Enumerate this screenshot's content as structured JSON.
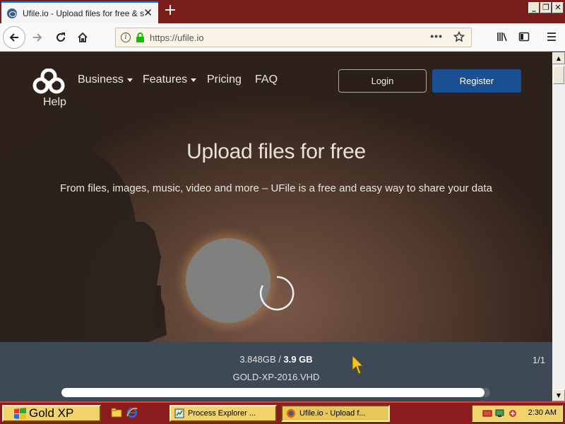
{
  "browser": {
    "tab_title": "Ufile.io - Upload files for free & sh",
    "url": "https://ufile.io",
    "more_icon_text": "•••"
  },
  "site": {
    "nav": {
      "business": "Business",
      "features": "Features",
      "pricing": "Pricing",
      "faq": "FAQ",
      "help": "Help"
    },
    "login_label": "Login",
    "register_label": "Register",
    "hero_title": "Upload files for free",
    "hero_subtitle": "From files, images, music, video and more – UFile is a free and easy way to share your data"
  },
  "upload": {
    "uploaded": "3.848GB",
    "separator": " / ",
    "total": "3.9 GB",
    "filename": "GOLD-XP-2016.VHD",
    "count": "1/1",
    "progress_fraction": 0.987
  },
  "taskbar": {
    "start_label": "Gold XP",
    "tasks": [
      {
        "label": "Process Explorer ...",
        "icon": "process-explorer-icon"
      },
      {
        "label": "Ufile.io - Upload f...",
        "icon": "firefox-icon"
      }
    ],
    "clock": "2:30 AM"
  },
  "colors": {
    "register_button": "#1b4f93",
    "taskbar": "#8c1b1d",
    "start_button": "#f2d36b",
    "upload_panel": "#3d4a55"
  }
}
